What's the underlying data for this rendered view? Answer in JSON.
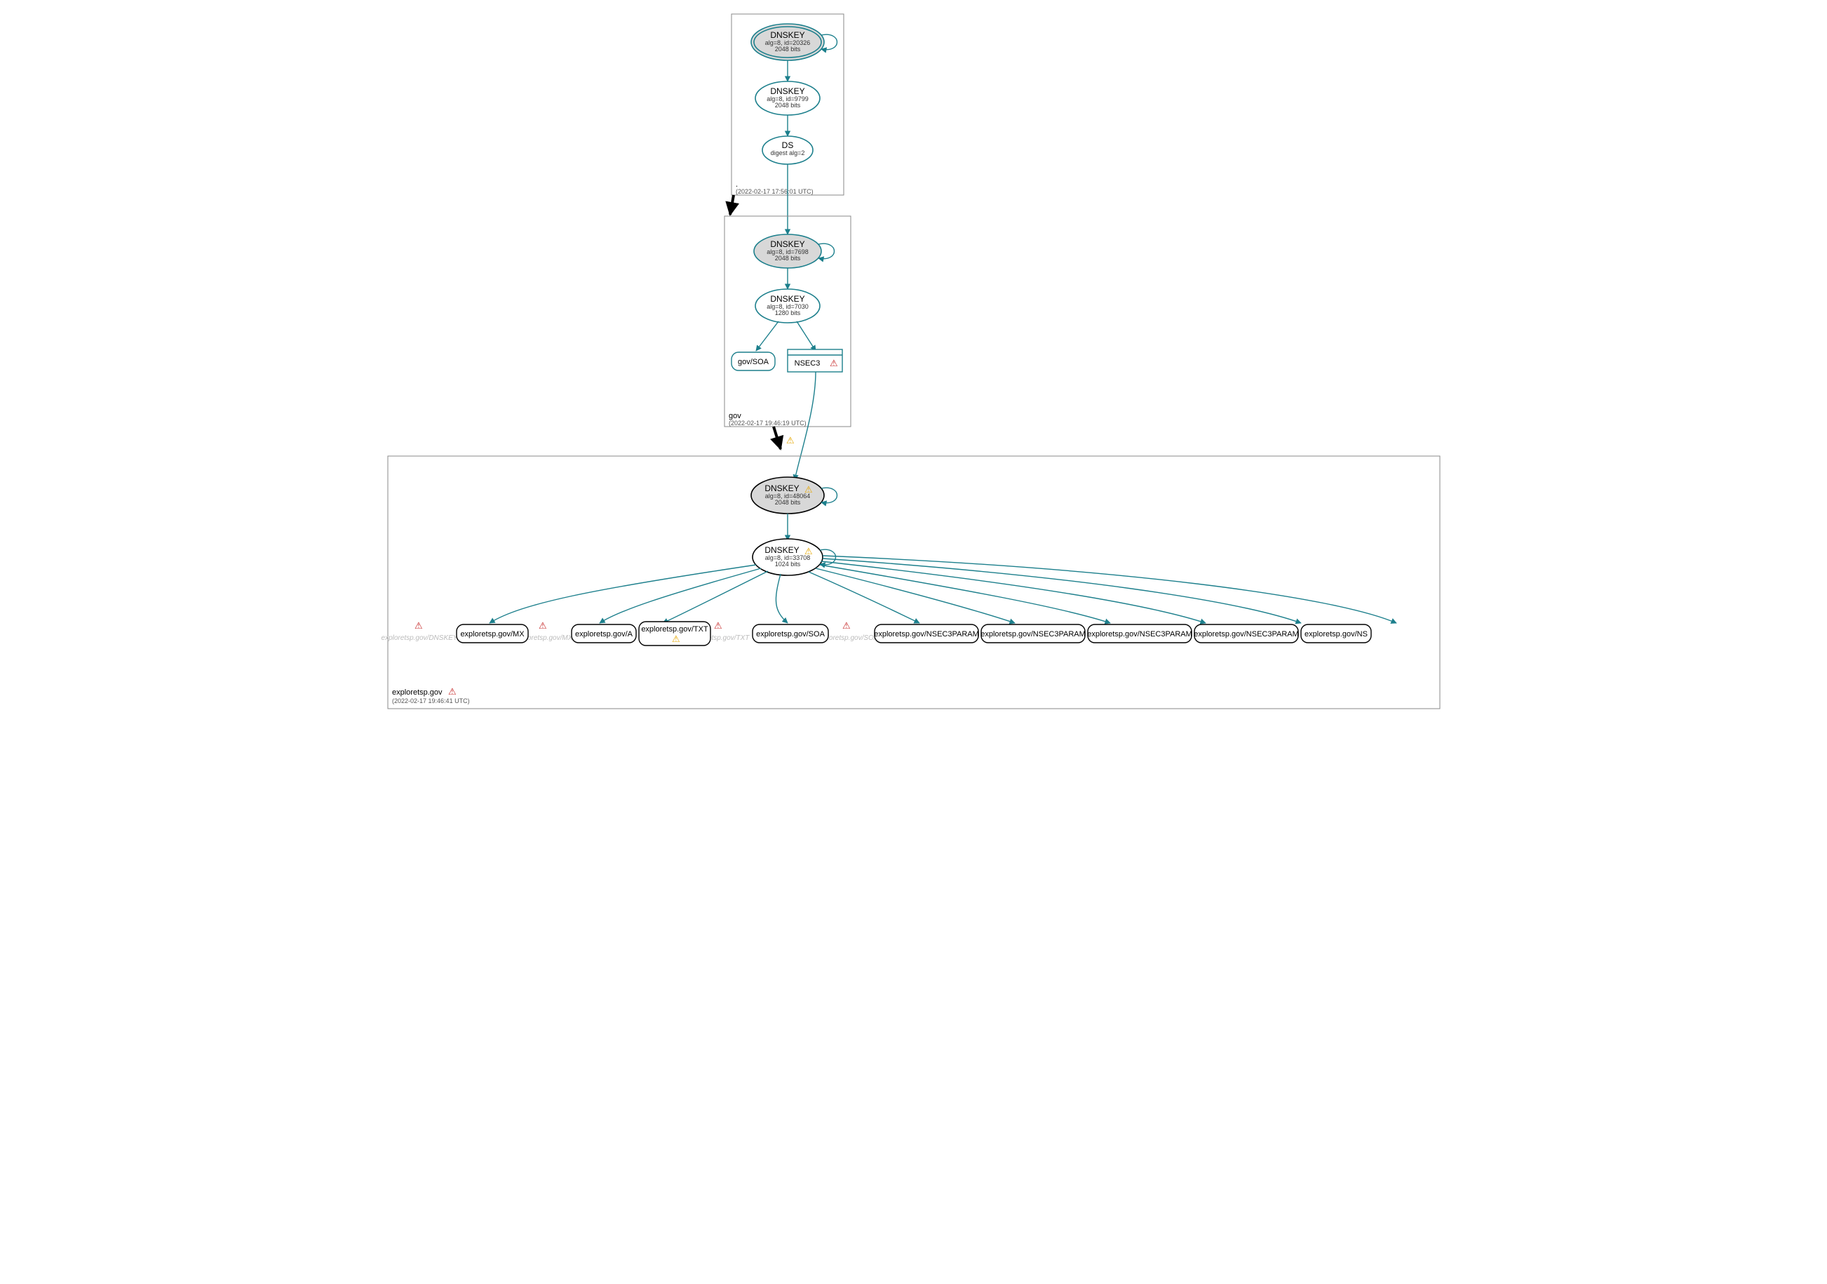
{
  "zones": {
    "root": {
      "name": ".",
      "timestamp": "(2022-02-17 17:56:01 UTC)",
      "ksk": {
        "title": "DNSKEY",
        "line2": "alg=8, id=20326",
        "line3": "2048 bits"
      },
      "zsk": {
        "title": "DNSKEY",
        "line2": "alg=8, id=9799",
        "line3": "2048 bits"
      },
      "ds": {
        "title": "DS",
        "line2": "digest alg=2"
      }
    },
    "gov": {
      "name": "gov",
      "timestamp": "(2022-02-17 19:46:19 UTC)",
      "ksk": {
        "title": "DNSKEY",
        "line2": "alg=8, id=7698",
        "line3": "2048 bits"
      },
      "zsk": {
        "title": "DNSKEY",
        "line2": "alg=8, id=7030",
        "line3": "1280 bits"
      },
      "soa": "gov/SOA",
      "nsec3": "NSEC3"
    },
    "exploretsp": {
      "name": "exploretsp.gov",
      "timestamp": "(2022-02-17 19:46:41 UTC)",
      "ksk": {
        "title": "DNSKEY",
        "line2": "alg=8, id=48064",
        "line3": "2048 bits"
      },
      "zsk": {
        "title": "DNSKEY",
        "line2": "alg=8, id=33708",
        "line3": "1024 bits"
      }
    }
  },
  "ghosts": {
    "dnskey": "exploretsp.gov/DNSKEY",
    "mx": "exploretsp.gov/MX",
    "txt": "exploretsp.gov/TXT",
    "soa": "exploretsp.gov/SOA"
  },
  "leaves": {
    "mx": "exploretsp.gov/MX",
    "a": "exploretsp.gov/A",
    "txt": "exploretsp.gov/TXT",
    "soa": "exploretsp.gov/SOA",
    "np1": "exploretsp.gov/NSEC3PARAM",
    "np2": "exploretsp.gov/NSEC3PARAM",
    "np3": "exploretsp.gov/NSEC3PARAM",
    "np4": "exploretsp.gov/NSEC3PARAM",
    "ns": "exploretsp.gov/NS"
  },
  "icons": {
    "warn_y": "⚠",
    "warn_r": "⚠"
  }
}
